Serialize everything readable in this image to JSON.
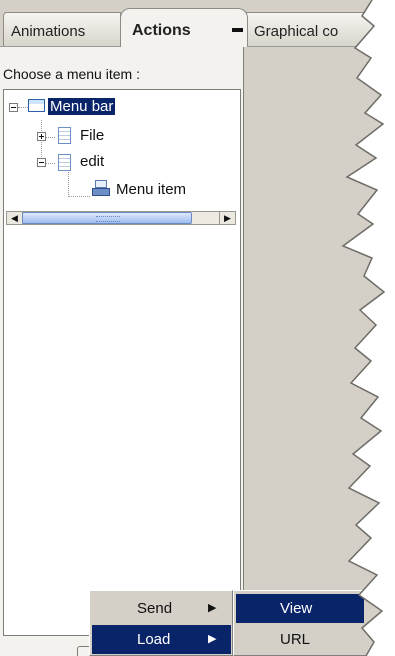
{
  "tabs": [
    {
      "label": "Animations"
    },
    {
      "label": "Actions"
    },
    {
      "label": "Graphical co"
    }
  ],
  "panel": {
    "label": "Choose a menu item :"
  },
  "tree": {
    "root": {
      "label": "Menu bar"
    },
    "file": {
      "label": "File"
    },
    "edit": {
      "label": "edit"
    },
    "menu_item": {
      "label": "Menu item"
    }
  },
  "context_menu": {
    "items": [
      {
        "label": "Send"
      },
      {
        "label": "Load"
      }
    ]
  },
  "submenu": {
    "items": [
      {
        "label": "View"
      },
      {
        "label": "URL"
      }
    ]
  },
  "colors": {
    "selection": "#0a246a",
    "chrome": "#d4d0c8",
    "panel": "#f3f2ee"
  }
}
